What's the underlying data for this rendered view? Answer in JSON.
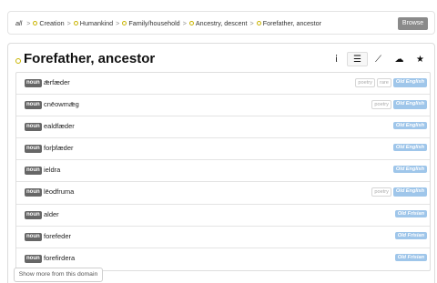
{
  "breadcrumb": {
    "all": "all",
    "sep": ">",
    "items": [
      "Creation",
      "Humankind",
      "Family/household",
      "Ancestry, descent",
      "Forefather, ancestor"
    ],
    "browse_label": "Browse"
  },
  "header": {
    "title": "Forefather, ancestor",
    "tools": [
      "info-icon",
      "list-icon",
      "chart-icon",
      "cloud-icon",
      "star-icon"
    ],
    "tool_glyphs": [
      "ἰ",
      "☰",
      "⟋",
      "☁",
      "★"
    ]
  },
  "entries": [
    {
      "pos": "noun",
      "word": "ǣrfæder",
      "tags": [
        "poetry",
        "rare"
      ],
      "language": "Old English"
    },
    {
      "pos": "noun",
      "word": "cnēowmǣg",
      "tags": [
        "poetry"
      ],
      "language": "Old English"
    },
    {
      "pos": "noun",
      "word": "ealdfæder",
      "tags": [],
      "language": "Old English"
    },
    {
      "pos": "noun",
      "word": "forþfæder",
      "tags": [],
      "language": "Old English"
    },
    {
      "pos": "noun",
      "word": "ieldra",
      "tags": [],
      "language": "Old English"
    },
    {
      "pos": "noun",
      "word": "lēodfruma",
      "tags": [
        "poetry"
      ],
      "language": "Old English"
    },
    {
      "pos": "noun",
      "word": "alder",
      "tags": [],
      "language": "Old Frisian"
    },
    {
      "pos": "noun",
      "word": "forefeder",
      "tags": [],
      "language": "Old Frisian"
    },
    {
      "pos": "noun",
      "word": "forefirdera",
      "tags": [],
      "language": "Old Frisian"
    }
  ],
  "show_more_label": "Show more from this domain",
  "colors": {
    "accent_dot": "#c9b400",
    "language_badge": "#9fc6ea",
    "pos_badge": "#666666",
    "browse_button": "#8a8a8a"
  }
}
